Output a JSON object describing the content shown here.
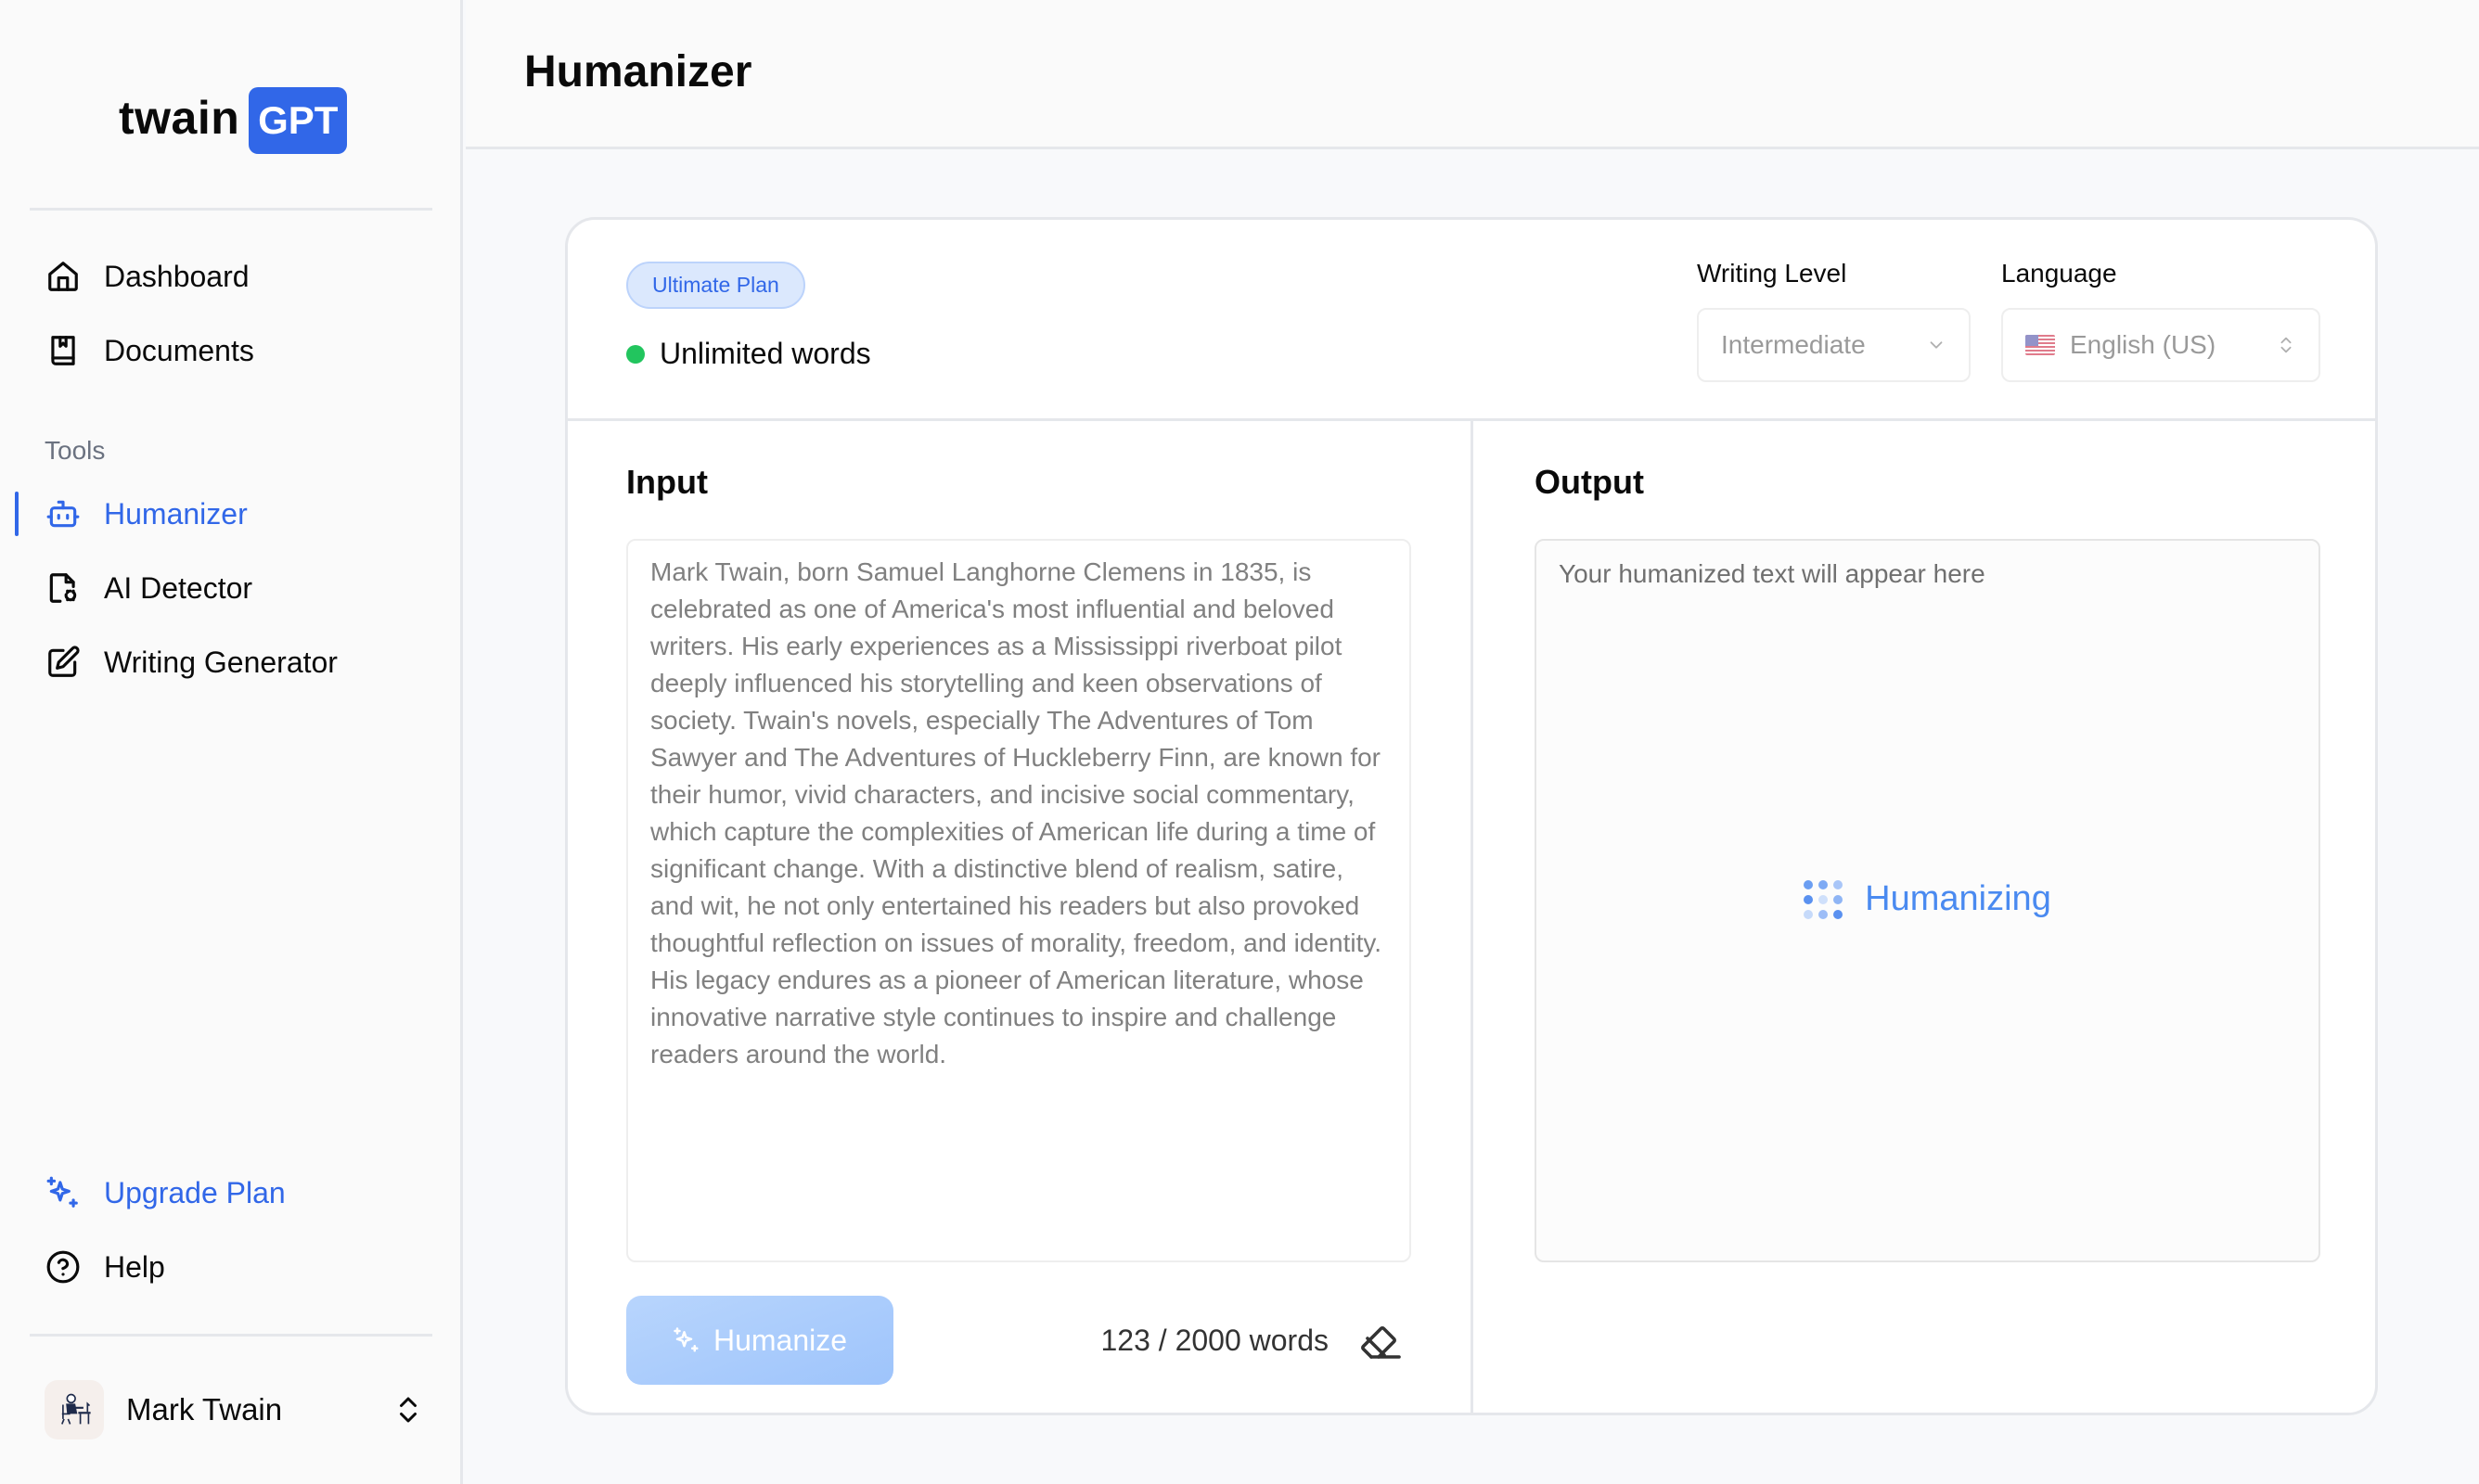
{
  "app": {
    "logo_word": "twain",
    "logo_badge": "GPT",
    "brand_color": "#3167e8"
  },
  "sidebar": {
    "nav": [
      {
        "label": "Dashboard",
        "icon": "home-icon"
      },
      {
        "label": "Documents",
        "icon": "book-icon"
      }
    ],
    "tools_label": "Tools",
    "tools": [
      {
        "label": "Humanizer",
        "icon": "bot-icon",
        "active": true
      },
      {
        "label": "AI Detector",
        "icon": "file-scan-icon"
      },
      {
        "label": "Writing Generator",
        "icon": "edit-icon"
      }
    ],
    "bottom": [
      {
        "label": "Upgrade Plan",
        "icon": "sparkles-icon"
      },
      {
        "label": "Help",
        "icon": "help-circle-icon"
      }
    ],
    "user": {
      "name": "Mark Twain"
    }
  },
  "header": {
    "title": "Humanizer"
  },
  "settings": {
    "plan_badge": "Ultimate Plan",
    "word_status": "Unlimited words",
    "status_color": "#22c55e",
    "writing_level_label": "Writing Level",
    "writing_level_value": "Intermediate",
    "language_label": "Language",
    "language_value": "English (US)"
  },
  "input": {
    "title": "Input",
    "text": "Mark Twain, born Samuel Langhorne Clemens in 1835, is celebrated as one of America's most influential and beloved writers. His early experiences as a Mississippi riverboat pilot deeply influenced his storytelling and keen observations of society. Twain's novels, especially The Adventures of Tom Sawyer and The Adventures of Huckleberry Finn, are known for their humor, vivid characters, and incisive social commentary, which capture the complexities of American life during a time of significant change. With a distinctive blend of realism, satire, and wit, he not only entertained his readers but also provoked thoughtful reflection on issues of morality, freedom, and identity. His legacy endures as a pioneer of American literature, whose innovative narrative style continues to inspire and challenge readers around the world.",
    "humanize_button": "Humanize",
    "word_count": "123 / 2000 words"
  },
  "output": {
    "title": "Output",
    "placeholder": "Your humanized text will appear here",
    "loading_text": "Humanizing"
  }
}
